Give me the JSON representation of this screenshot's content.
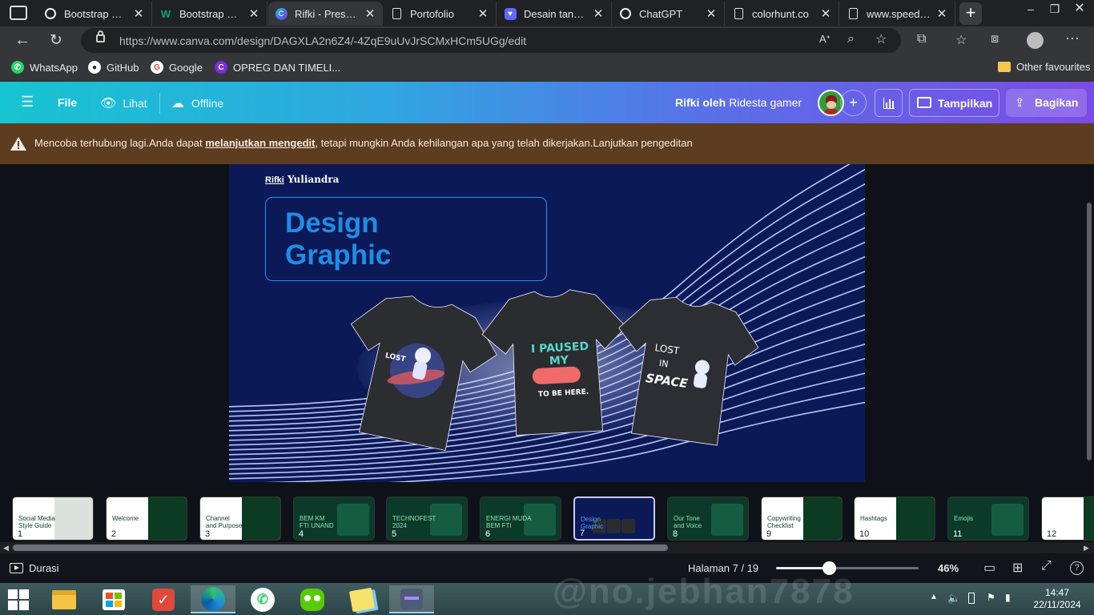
{
  "browser": {
    "tabs": [
      {
        "title": "Bootstrap Mod",
        "icon": "chatgpt-icon"
      },
      {
        "title": "Bootstrap 5 Tu",
        "icon": "w3schools-icon"
      },
      {
        "title": "Rifki - Presenta",
        "icon": "canva-icon",
        "active": true
      },
      {
        "title": "Portofolio",
        "icon": "page-icon"
      },
      {
        "title": "Desain tanpa ju",
        "icon": "heart-icon"
      },
      {
        "title": "ChatGPT",
        "icon": "chatgpt-icon"
      },
      {
        "title": "colorhunt.co",
        "icon": "page-icon"
      },
      {
        "title": "www.speedtes",
        "icon": "page-icon"
      }
    ],
    "url": "https://www.canva.com/design/DAGXLA2n6Z4/-4ZqE9uUvJrSCMxHCm5UGg/edit",
    "bookmarks": [
      {
        "label": "WhatsApp",
        "icon": "whatsapp-icon",
        "color": "#25d366"
      },
      {
        "label": "GitHub",
        "icon": "github-icon",
        "color": "#ffffff"
      },
      {
        "label": "Google",
        "icon": "google-icon",
        "color": "#ea4335"
      },
      {
        "label": "OPREG DAN TIMELI...",
        "icon": "canva-icon",
        "color": "#7d2ae8"
      }
    ],
    "other_favourites": "Other favourites"
  },
  "canva": {
    "file_menu": "File",
    "view_label": "Lihat",
    "offline_label": "Offline",
    "doc_title": "Rifki",
    "by_label": "oleh",
    "author": "Ridesta gamer",
    "present_label": "Tampilkan",
    "share_label": "Bagikan",
    "banner": {
      "text_before": "Mencoba terhubung lagi.Anda dapat ",
      "link": "melanjutkan mengedit",
      "text_after": ", tetapi mungkin Anda kehilangan apa yang telah dikerjakan.Lanjutkan pengeditan"
    },
    "slide": {
      "name_first": "Rifki",
      "name_last": "Yuliandra",
      "title_line1": "Design",
      "title_line2": "Graphic",
      "shirt1_text": "LOST",
      "shirt2_line1": "I PAUSED",
      "shirt2_line2": "MY",
      "shirt2_line3": "TO BE HERE.",
      "shirt3_line1": "LOST",
      "shirt3_line2": "IN",
      "shirt3_line3": "SPACE"
    },
    "thumbnails": [
      {
        "num": "1",
        "title": "Social Media\nStyle Guide",
        "theme": "light"
      },
      {
        "num": "2",
        "title": "Welcome",
        "theme": "light"
      },
      {
        "num": "3",
        "title": "Channel\nand Purpose",
        "theme": "light"
      },
      {
        "num": "4",
        "title": "BEM KM\nFTI UNAND",
        "theme": "dark"
      },
      {
        "num": "5",
        "title": "TECHNOFEST\n2024",
        "theme": "dark"
      },
      {
        "num": "6",
        "title": "ENERGI MUDA\nBEM FTI",
        "theme": "dark"
      },
      {
        "num": "7",
        "title": "Design\nGraphic",
        "theme": "navy",
        "active": true
      },
      {
        "num": "8",
        "title": "Our Tone\nand Voice",
        "theme": "dark"
      },
      {
        "num": "9",
        "title": "Copywriting\nChecklist",
        "theme": "light"
      },
      {
        "num": "10",
        "title": "Hashtags",
        "theme": "light"
      },
      {
        "num": "11",
        "title": "Emojis",
        "theme": "dark"
      },
      {
        "num": "12",
        "title": "",
        "theme": "light"
      }
    ],
    "footer": {
      "duration_label": "Durasi",
      "page_label": "Halaman 7 / 19",
      "zoom": "46%",
      "zoom_fraction": 0.37
    }
  },
  "taskbar": {
    "apps": [
      "windows-start-icon",
      "file-explorer-icon",
      "microsoft-store-icon",
      "tasks-icon",
      "edge-icon",
      "whatsapp-icon",
      "duolingo-icon",
      "sticky-notes-icon",
      "canva-app-icon"
    ],
    "time": "14:47",
    "date": "22/11/2024",
    "watermark": "@no.jebhan7878"
  },
  "colors": {
    "accent_cyan": "#17c4d1",
    "accent_purple": "#7a4be6",
    "slide_bg": "#0b1a57",
    "title_blue": "#1e8de6",
    "banner_bg": "#5d3c1f"
  }
}
